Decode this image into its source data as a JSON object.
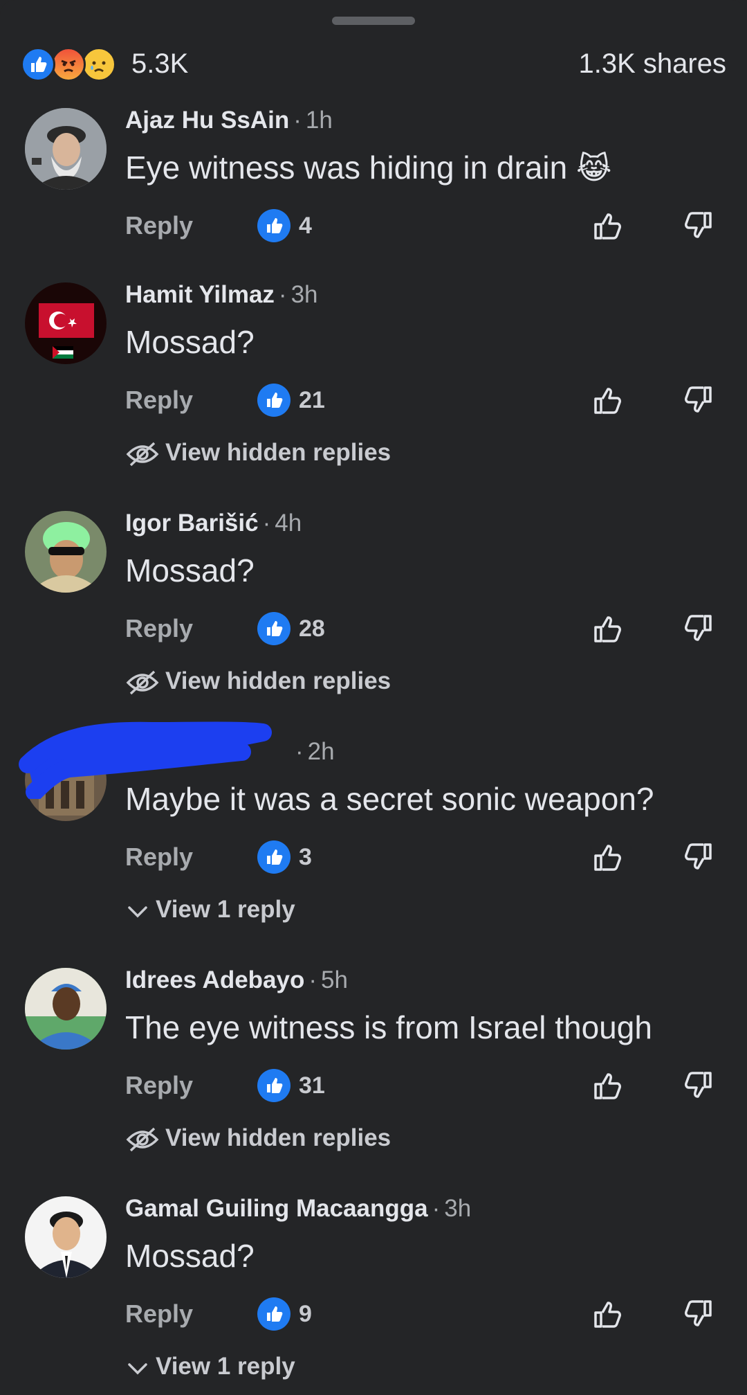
{
  "post_stats": {
    "reaction_icons": [
      "like-icon",
      "angry-icon",
      "sad-icon"
    ],
    "reaction_count": "5.3K",
    "shares": "1.3K shares"
  },
  "labels": {
    "reply": "Reply",
    "separator": "·"
  },
  "colors": {
    "background": "#242527",
    "like_blue": "#1f7bf2",
    "text_primary": "#e4e6eb",
    "text_secondary": "#a8abaf"
  },
  "comments": [
    {
      "author": "Ajaz Hu SsAin",
      "time": "1h",
      "text": "Eye witness was hiding in drain",
      "emoji": "😹",
      "likes": "4",
      "sub_link": ""
    },
    {
      "author": "Hamit Yilmaz",
      "time": "3h",
      "text": "Mossad?",
      "likes": "21",
      "sub_link": "View hidden replies"
    },
    {
      "author": "Igor Barišić",
      "time": "4h",
      "text": "Mossad?",
      "likes": "28",
      "sub_link": "View hidden replies"
    },
    {
      "author": "[redacted]",
      "time": "2h",
      "text": "Maybe it was a secret sonic weapon?",
      "likes": "3",
      "sub_link": "View 1 reply"
    },
    {
      "author": "Idrees Adebayo",
      "time": "5h",
      "text": "The eye witness is from Israel though",
      "likes": "31",
      "sub_link": "View hidden replies"
    },
    {
      "author": "Gamal Guiling Macaangga",
      "time": "3h",
      "text": "Mossad?",
      "likes": "9",
      "sub_link": "View 1 reply"
    }
  ]
}
